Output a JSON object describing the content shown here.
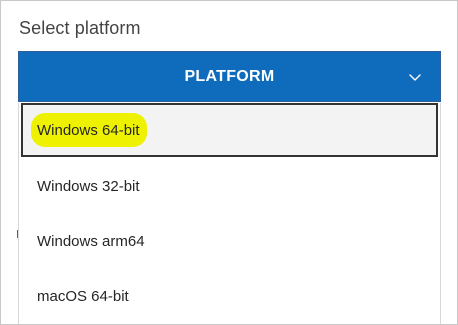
{
  "header": {
    "label": "Select platform"
  },
  "platform_button": {
    "label": "PLATFORM",
    "icon": "chevron-down-icon",
    "color": "#0f6cbd"
  },
  "dropdown": {
    "options": [
      {
        "label": "Windows 64-bit",
        "selected": true,
        "highlight_color": "#eef200"
      },
      {
        "label": "Windows 32-bit",
        "selected": false
      },
      {
        "label": "Windows arm64",
        "selected": false
      },
      {
        "label": "macOS 64-bit",
        "selected": false
      }
    ]
  }
}
